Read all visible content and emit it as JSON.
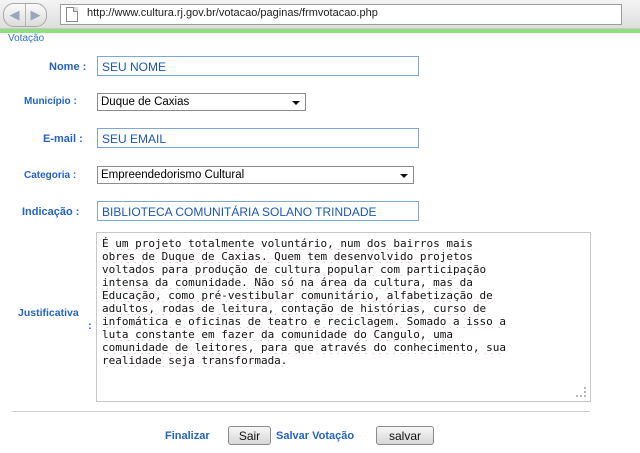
{
  "browser": {
    "url": "http://www.cultura.rj.gov.br/votacao/paginas/frmvotacao.php",
    "back_icon": "back-arrow-icon",
    "forward_icon": "forward-arrow-icon"
  },
  "page": {
    "title": "Votação"
  },
  "form": {
    "nome": {
      "label": "Nome :",
      "value": "SEU NOME"
    },
    "municipio": {
      "label": "Município :",
      "value": "Duque de Caxias"
    },
    "email": {
      "label": "E-mail :",
      "value": "SEU EMAIL"
    },
    "categoria": {
      "label": "Categoria :",
      "value": "Empreendedorismo Cultural"
    },
    "indicacao": {
      "label": "Indicação :",
      "value": "BIBLIOTECA COMUNITÁRIA SOLANO TRINDADE"
    },
    "justificativa": {
      "label_line1": "Justificativa",
      "label_line2": ":",
      "lines": [
        "É um projeto totalmente voluntário, num dos bairros mais",
        "obres de Duque de Caxias. Quem tem desenvolvido projetos",
        "voltados para produção de cultura popular com participação",
        "intensa da comunidade. Não só na área da cultura, mas da",
        "Educação, como pré-vestibular comunitário, alfabetização de",
        "adultos, rodas de leitura, contação de histórias, curso de",
        "infomática e oficinas de teatro e reciclagem. Somado a isso a",
        "luta constante em fazer da comunidade do Cangulo, uma",
        "comunidade de leitores, para que através do conhecimento, sua",
        "realidade seja transformada."
      ]
    }
  },
  "actions": {
    "finalizar_label": "Finalizar",
    "sair_button": "Sair",
    "salvar_label": "Salvar Votação",
    "salvar_button": "salvar"
  }
}
